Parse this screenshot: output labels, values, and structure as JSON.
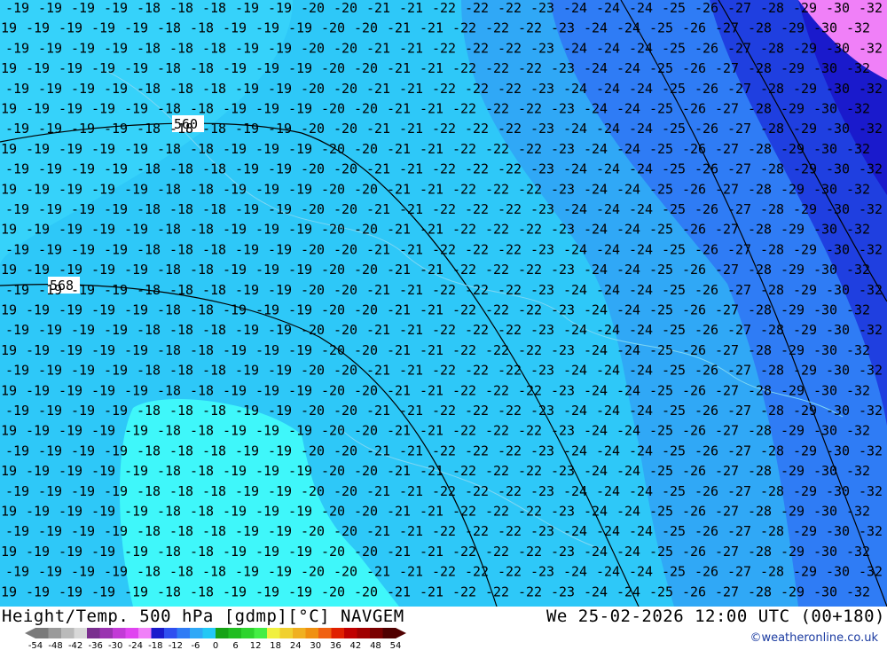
{
  "map": {
    "contour_labels": [
      "560",
      "568"
    ],
    "temperature_field": [
      {
        "y": "top",
        "labels": [
          "-19",
          "-19",
          "-19",
          "-19",
          "-18",
          "-18",
          "-18",
          "-19",
          "-19",
          "-20",
          "-20",
          "-21",
          "-21",
          "-22",
          "-22",
          "-22",
          "-23",
          "-24",
          "-24",
          "-24",
          "-25",
          "-26",
          "-27",
          "-28",
          "-29",
          "-30",
          "-32"
        ]
      },
      {
        "y": "row",
        "labels": [
          "-19",
          "-19",
          "-19",
          "-19",
          "-19",
          "-18",
          "-18",
          "-19",
          "-19",
          "-19",
          "-20",
          "-20",
          "-21",
          "-21",
          "-22",
          "-22",
          "-22",
          "-23",
          "-24",
          "-24",
          "-25",
          "-26",
          "-27",
          "-28",
          "-29",
          "-30",
          "-32"
        ]
      }
    ]
  },
  "footer": {
    "title_left": "Height/Temp. 500 hPa [gdmp][°C] NAVGEM",
    "title_right": "We 25-02-2026 12:00 UTC (00+180)",
    "credit": "©weatheronline.co.uk",
    "legend_ticks": [
      "-54",
      "-48",
      "-42",
      "-36",
      "-30",
      "-24",
      "-18",
      "-12",
      "-6",
      "0",
      "6",
      "12",
      "18",
      "24",
      "30",
      "36",
      "42",
      "48",
      "54"
    ],
    "legend_colors": [
      "#7a7a7a",
      "#9a9a9a",
      "#bababa",
      "#d8d8d8",
      "#7a2f8f",
      "#9a33b0",
      "#c23ad6",
      "#e045f0",
      "#f080f8",
      "#1a1acc",
      "#2f4ff0",
      "#2f7cf5",
      "#2fa8f7",
      "#22c8f5",
      "#16a316",
      "#21bd21",
      "#2ed42e",
      "#44ee44",
      "#f0f040",
      "#f0d030",
      "#f0b020",
      "#f09010",
      "#f06010",
      "#e02000",
      "#c00000",
      "#a00000",
      "#7a0000",
      "#500000"
    ]
  }
}
